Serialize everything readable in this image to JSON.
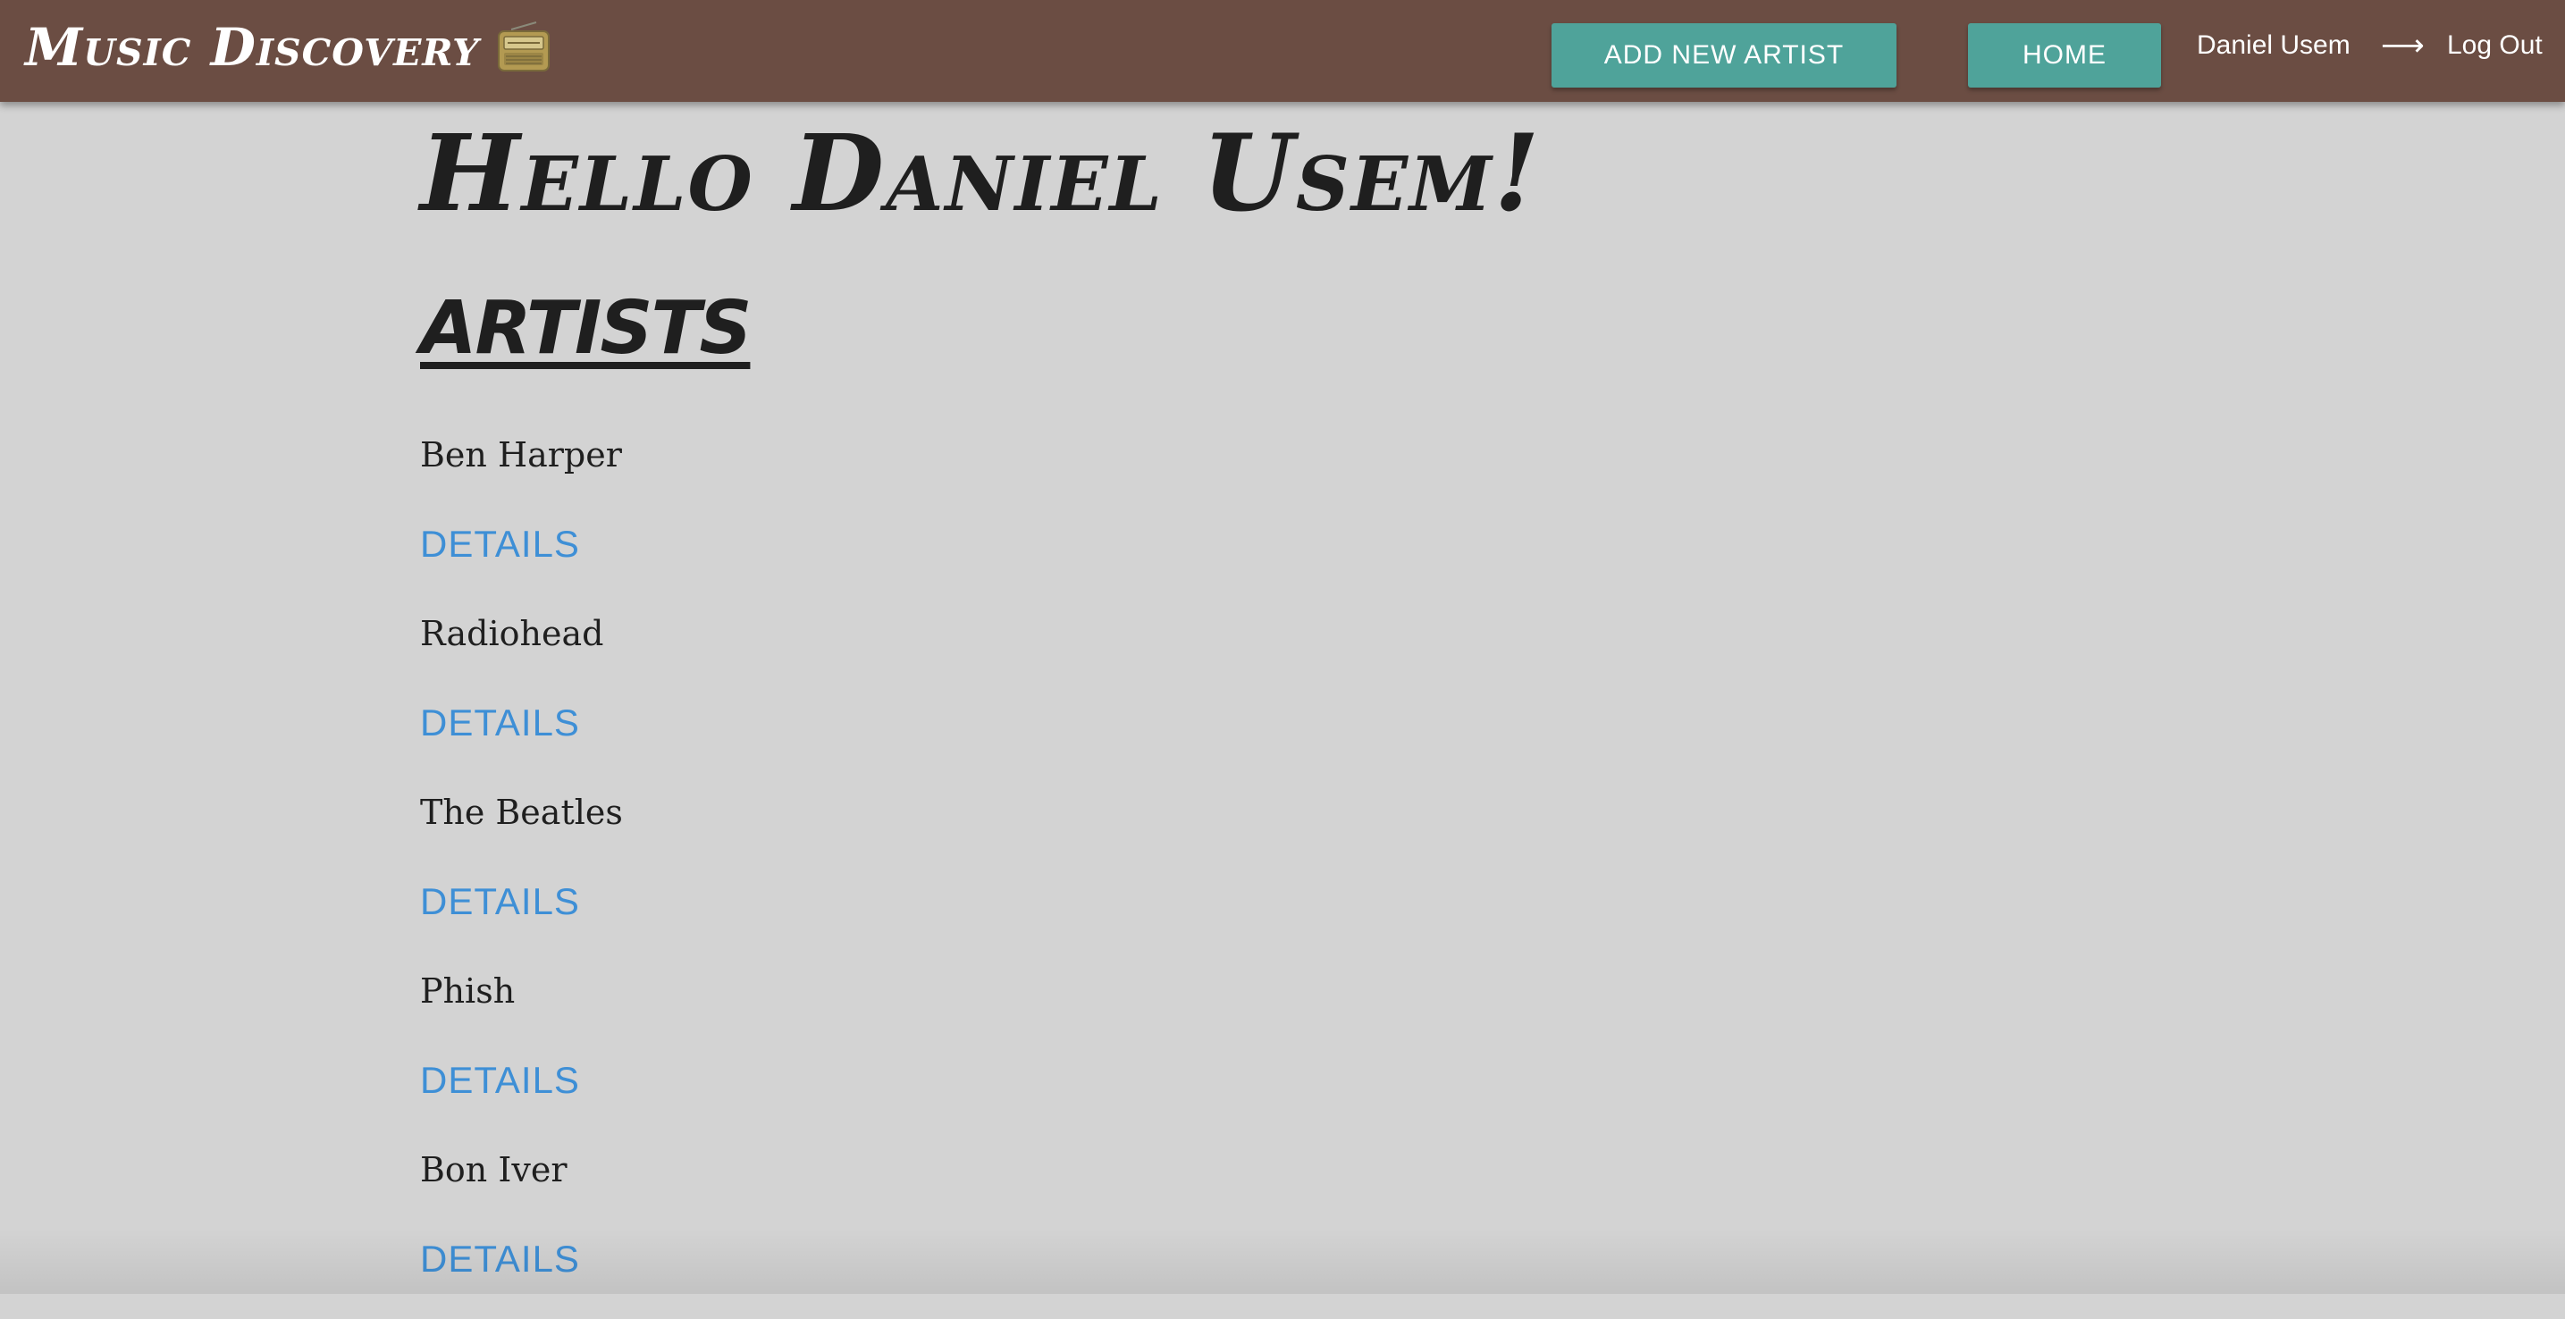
{
  "navbar": {
    "brand": "Music Discovery",
    "brand_icon": "radio-icon",
    "add_artist_label": "ADD NEW ARTIST",
    "home_label": "HOME",
    "user_name": "Daniel Usem",
    "arrow": "⟶",
    "logout_label": "Log Out"
  },
  "main": {
    "greeting": "Hello Daniel Usem!",
    "section_title": "ARTISTS",
    "artists": [
      {
        "name": "Ben Harper",
        "details_label": "DETAILS"
      },
      {
        "name": "Radiohead",
        "details_label": "DETAILS"
      },
      {
        "name": "The Beatles",
        "details_label": "DETAILS"
      },
      {
        "name": "Phish",
        "details_label": "DETAILS"
      },
      {
        "name": "Bon Iver",
        "details_label": "DETAILS"
      }
    ]
  },
  "colors": {
    "navbar_bg": "#6b4d43",
    "page_bg": "#d3d3d3",
    "button_bg": "#4fa39a",
    "link": "#3e8fd6",
    "text": "#1f1f1f"
  }
}
